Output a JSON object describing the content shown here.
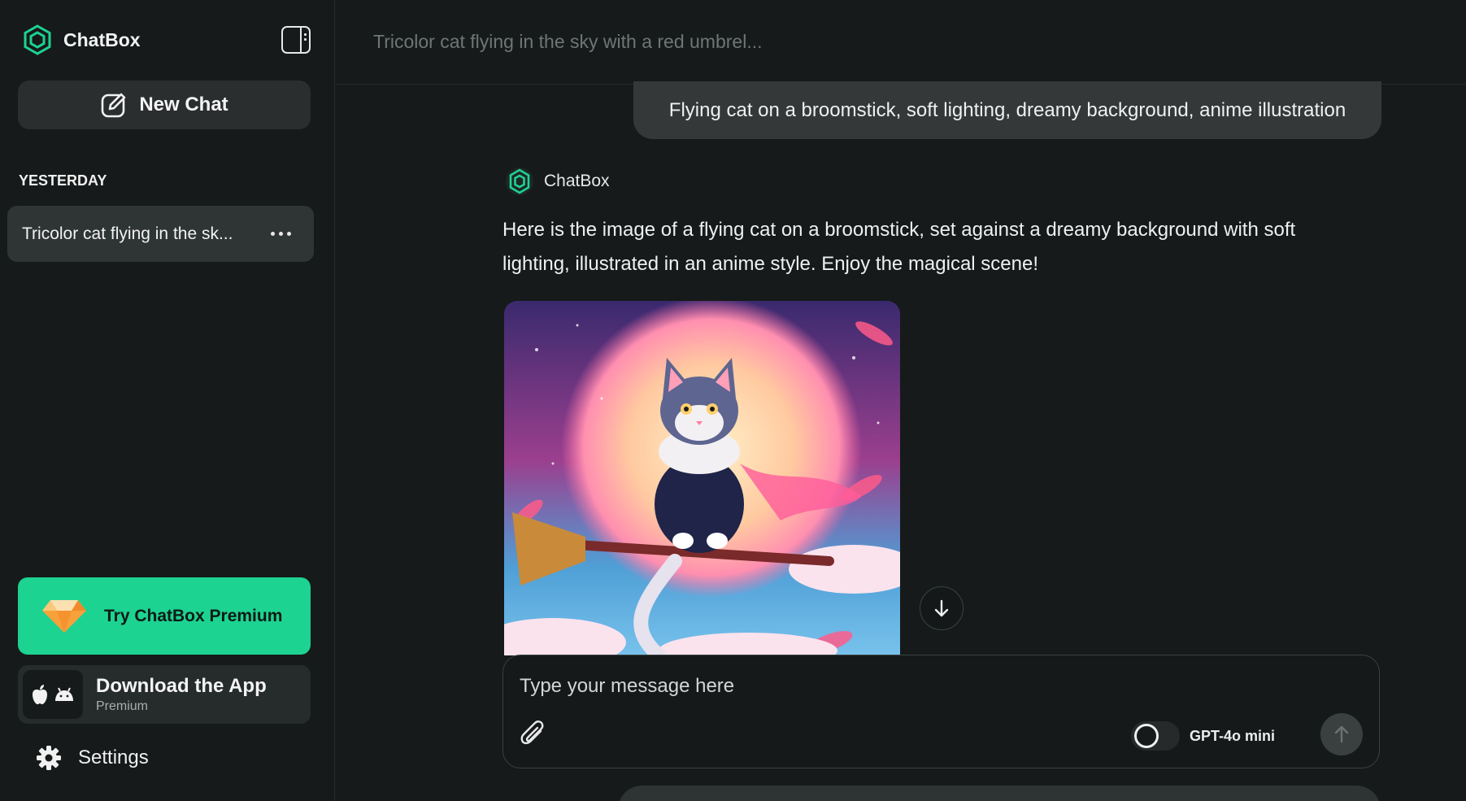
{
  "sidebar": {
    "brand": "ChatBox",
    "new_chat_label": "New Chat",
    "section_label": "YESTERDAY",
    "chats": [
      {
        "title": "Tricolor cat flying in the sk..."
      }
    ],
    "premium_label": "Try ChatBox Premium",
    "download": {
      "title": "Download the App",
      "subtitle": "Premium"
    },
    "settings_label": "Settings"
  },
  "header": {
    "conversation_title": "Tricolor cat flying in the sky with a red umbrel..."
  },
  "messages": {
    "user": "Flying cat on a broomstick, soft lighting, dreamy background, anime illustration",
    "assistant_name": "ChatBox",
    "assistant_text": "Here is the image of a flying cat on a broomstick, set against a dreamy background with soft lighting, illustrated in an anime style. Enjoy the magical scene!"
  },
  "composer": {
    "placeholder": "Type your message here",
    "model": "GPT-4o mini"
  },
  "colors": {
    "accent": "#1dd392",
    "background": "#161a1a",
    "bubble": "#343838"
  },
  "icons": [
    "chatbox-logo-icon",
    "sidebar-toggle-icon",
    "edit-icon",
    "more-icon",
    "diamond-icon",
    "apple-icon",
    "android-icon",
    "gear-icon",
    "arrow-down-icon",
    "paperclip-icon",
    "arrow-up-icon"
  ]
}
